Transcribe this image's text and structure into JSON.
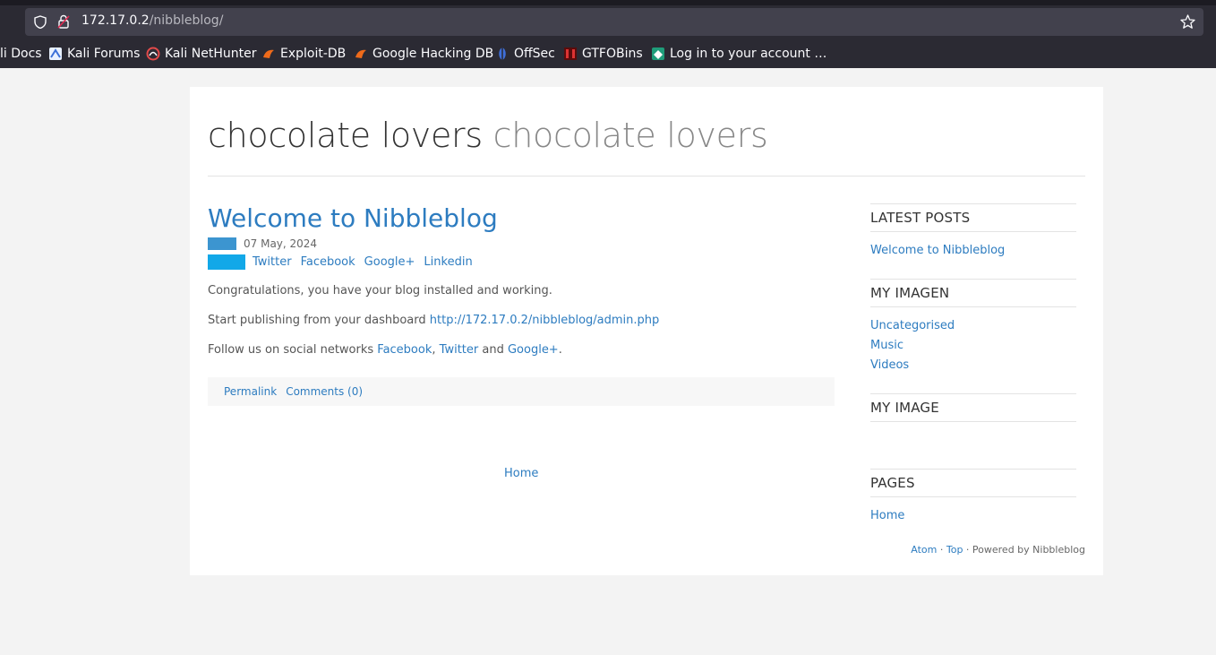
{
  "browser": {
    "url_host": "172.17.0.2",
    "url_path": "/nibbleblog/",
    "bookmarks": [
      {
        "label": "li Docs",
        "icon": "kali-docs-icon"
      },
      {
        "label": "Kali Forums",
        "icon": "kali-forums-icon"
      },
      {
        "label": "Kali NetHunter",
        "icon": "kali-nethunter-icon"
      },
      {
        "label": "Exploit-DB",
        "icon": "exploit-db-icon"
      },
      {
        "label": "Google Hacking DB",
        "icon": "google-hacking-db-icon"
      },
      {
        "label": "OffSec",
        "icon": "offsec-icon"
      },
      {
        "label": "GTFOBins",
        "icon": "gtfobins-icon"
      },
      {
        "label": "Log in to your account …",
        "icon": "login-account-icon"
      }
    ]
  },
  "site": {
    "title": "chocolate lovers",
    "slogan": "chocolate lovers"
  },
  "post": {
    "title": "Welcome to Nibbleblog",
    "date": "07 May, 2024",
    "share": [
      "Twitter",
      "Facebook",
      "Google+",
      "Linkedin"
    ],
    "p1": "Congratulations, you have your blog installed and working.",
    "p2_text": "Start publishing from your dashboard ",
    "p2_link": "http://172.17.0.2/nibbleblog/admin.php",
    "p3_text": "Follow us on social networks ",
    "p3_facebook": "Facebook",
    "p3_comma": ",",
    "p3_twitter": "Twitter",
    "p3_and": " and ",
    "p3_google": "Google+",
    "p3_end": ".",
    "permalink": "Permalink",
    "comments": "Comments (0)"
  },
  "pager": {
    "home": "Home"
  },
  "sidebar": {
    "latest_posts": {
      "heading": "LATEST POSTS",
      "items": [
        "Welcome to Nibbleblog"
      ]
    },
    "my_imagen": {
      "heading": "MY IMAGEN",
      "items": [
        "Uncategorised",
        "Music",
        "Videos"
      ]
    },
    "my_image": {
      "heading": "MY IMAGE"
    },
    "pages": {
      "heading": "PAGES",
      "items": [
        "Home"
      ]
    }
  },
  "footer": {
    "atom": "Atom",
    "sep1": " · ",
    "top": "Top",
    "powered": " · Powered by Nibbleblog"
  },
  "colors": {
    "link": "#2d7cc0",
    "chrome_bg": "#2b2a33",
    "urlbar_bg": "#42414d",
    "page_bg": "#f3f3f3"
  }
}
